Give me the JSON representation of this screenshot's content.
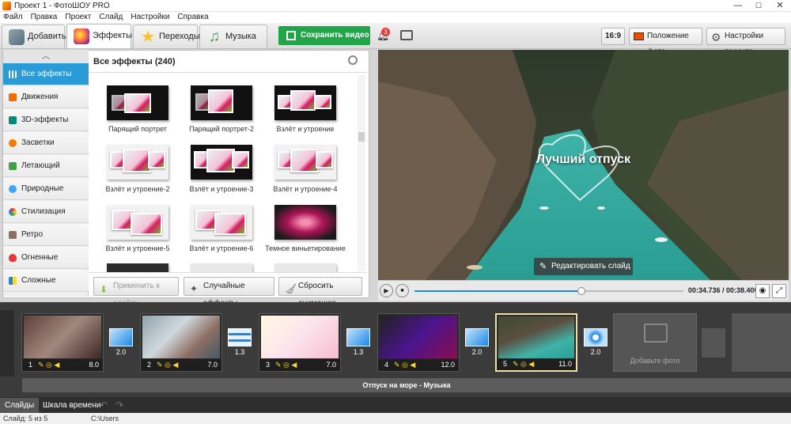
{
  "window": {
    "title": "Проект 1 - ФотоШОУ PRO",
    "min": "—",
    "max": "☐",
    "close": "✕"
  },
  "menu": [
    "Файл",
    "Правка",
    "Проект",
    "Слайд",
    "Настройки",
    "Справка"
  ],
  "tabs": [
    {
      "label": "Добавить",
      "icon": "add-photos-icon"
    },
    {
      "label": "Эффекты",
      "icon": "effects-icon"
    },
    {
      "label": "Переходы",
      "icon": "transitions-star-icon"
    },
    {
      "label": "Музыка",
      "icon": "music-note-icon"
    }
  ],
  "toolbar": {
    "save_label": "Сохранить видео",
    "notify_count": "3",
    "aspect": "16:9",
    "photo_position": "Положение фото",
    "project_settings": "Настройки проекта"
  },
  "categories": [
    "Все эффекты",
    "Движения",
    "3D-эффекты",
    "Засветки",
    "Летающий клипарт",
    "Природные",
    "Стилизация",
    "Ретро",
    "Огненные",
    "Сложные"
  ],
  "grid": {
    "title": "Все эффекты (240)",
    "items": [
      "Парящий портрет",
      "Парящий портрет-2",
      "Взлёт и утроение",
      "Взлёт и утроение-2",
      "Взлёт и утроение-3",
      "Взлёт и утроение-4",
      "Взлёт и утроение-5",
      "Взлёт и утроение-6",
      "Темное виньетирование"
    ]
  },
  "panel_buttons": {
    "apply": "Применить к слайду",
    "random": "Случайные эффекты",
    "reset": "Сбросить анимацию"
  },
  "preview": {
    "caption": "Лучший отпуск",
    "edit_slide": "Редактировать слайд",
    "time": "00:34.736 / 00:38.400",
    "progress": 0.62
  },
  "slides": [
    {
      "num": "1",
      "dur": "8.0"
    },
    {
      "num": "2",
      "dur": "7.0"
    },
    {
      "num": "3",
      "dur": "7.0"
    },
    {
      "num": "4",
      "dur": "12.0"
    },
    {
      "num": "5",
      "dur": "11.0"
    }
  ],
  "transitions": [
    "2.0",
    "1.3",
    "1.3",
    "2.0",
    "2.0"
  ],
  "add_photo": "Добавьте фото",
  "music": "Отпуск на море - Музыка",
  "bottom_tabs": [
    "Слайды",
    "Шкала времени"
  ],
  "status": {
    "slide": "Слайд: 5 из 5",
    "path": "C:\\Users"
  }
}
